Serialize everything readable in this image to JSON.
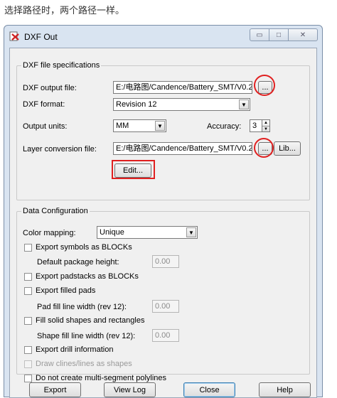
{
  "caption": "选择路径时，两个路径一样。",
  "window": {
    "title": "DXF Out",
    "minimize_glyph": "▭",
    "maximize_glyph": "□",
    "close_glyph": "✕"
  },
  "spec_group": {
    "label": "DXF file specifications",
    "output_file_label": "DXF output file:",
    "output_file_value": "E:/电路图/Candence/Battery_SMT/V0.2",
    "browse_label": "...",
    "format_label": "DXF format:",
    "format_value": "Revision 12",
    "units_label": "Output units:",
    "units_value": "MM",
    "accuracy_label": "Accuracy:",
    "accuracy_value": "3",
    "layer_file_label": "Layer conversion file:",
    "layer_file_value": "E:/电路图/Candence/Battery_SMT/V0.2",
    "layer_browse_label": "...",
    "lib_label": "Lib...",
    "edit_label": "Edit..."
  },
  "data_group": {
    "label": "Data Configuration",
    "color_mapping_label": "Color mapping:",
    "color_mapping_value": "Unique",
    "export_symbols_label": "Export symbols as BLOCKs",
    "default_pkg_height_label": "Default package height:",
    "default_pkg_height_value": "0.00",
    "export_padstacks_label": "Export padstacks as BLOCKs",
    "export_filled_pads_label": "Export filled pads",
    "pad_fill_label": "Pad fill line width (rev 12):",
    "pad_fill_value": "0.00",
    "fill_solid_label": "Fill solid shapes and rectangles",
    "shape_fill_label": "Shape fill line width (rev 12):",
    "shape_fill_value": "0.00",
    "export_drill_label": "Export drill information",
    "draw_clines_label": "Draw clines/lines as shapes",
    "no_multi_label": "Do not create multi-segment polylines"
  },
  "buttons": {
    "export": "Export",
    "view_log": "View Log",
    "close": "Close",
    "help": "Help"
  }
}
